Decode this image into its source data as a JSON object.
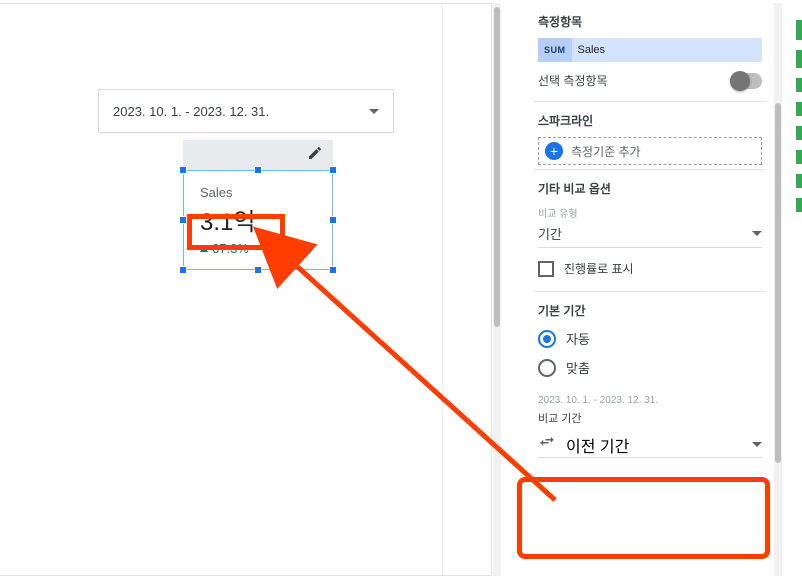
{
  "canvas": {
    "date_range": "2023. 10. 1. - 2023. 12. 31."
  },
  "scorecard": {
    "label": "Sales",
    "value": "3.1억",
    "delta": "67.3%"
  },
  "panel": {
    "metric_section_title": "측정항목",
    "metric_badge": "SUM",
    "metric_name": "Sales",
    "optional_metric_label": "선택 측정항목",
    "sparkline_title": "스파크라인",
    "sparkline_add": "측정기준 추가",
    "other_compare_title": "기타 비교 옵션",
    "compare_type_label": "비교 유형",
    "compare_type_value": "기간",
    "progress_checkbox": "진행률로 표시",
    "default_range_title": "기본 기간",
    "radio_auto": "자동",
    "radio_custom": "맞춤",
    "bottom_date": "2023. 10. 1. - 2023. 12. 31.",
    "compare_range_title": "비교 기간",
    "compare_range_value": "이전 기간"
  }
}
